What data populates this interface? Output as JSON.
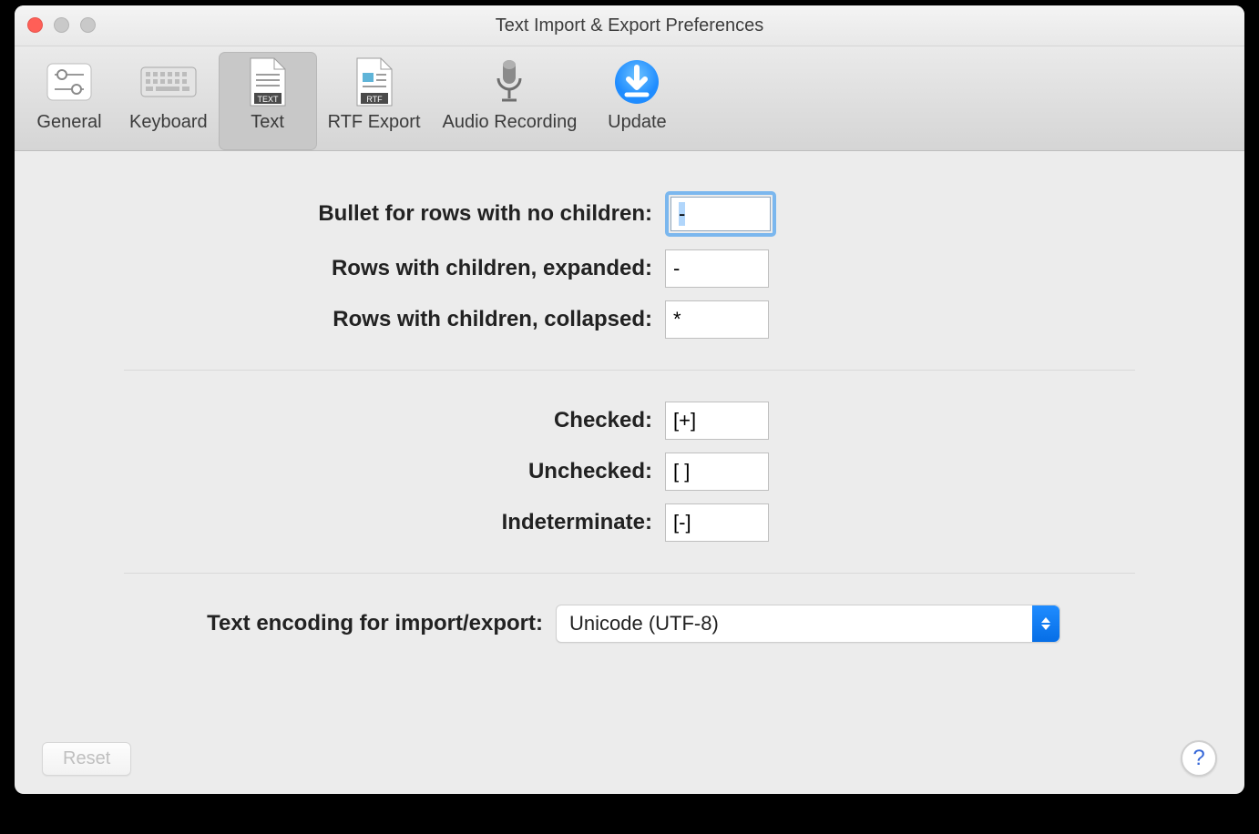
{
  "window": {
    "title": "Text Import & Export Preferences"
  },
  "toolbar": {
    "tabs": [
      {
        "label": "General"
      },
      {
        "label": "Keyboard"
      },
      {
        "label": "Text"
      },
      {
        "label": "RTF Export"
      },
      {
        "label": "Audio Recording"
      },
      {
        "label": "Update"
      }
    ],
    "selected_index": 2
  },
  "form": {
    "bullets": {
      "no_children_label": "Bullet for rows with no children:",
      "no_children_value": "-",
      "expanded_label": "Rows with children, expanded:",
      "expanded_value": "-",
      "collapsed_label": "Rows with children, collapsed:",
      "collapsed_value": "*"
    },
    "checkstate": {
      "checked_label": "Checked:",
      "checked_value": "[+]",
      "unchecked_label": "Unchecked:",
      "unchecked_value": "[ ]",
      "indeterminate_label": "Indeterminate:",
      "indeterminate_value": "[-]"
    },
    "encoding": {
      "label": "Text encoding for import/export:",
      "value": "Unicode (UTF-8)"
    }
  },
  "footer": {
    "reset_label": "Reset",
    "help_label": "?"
  }
}
